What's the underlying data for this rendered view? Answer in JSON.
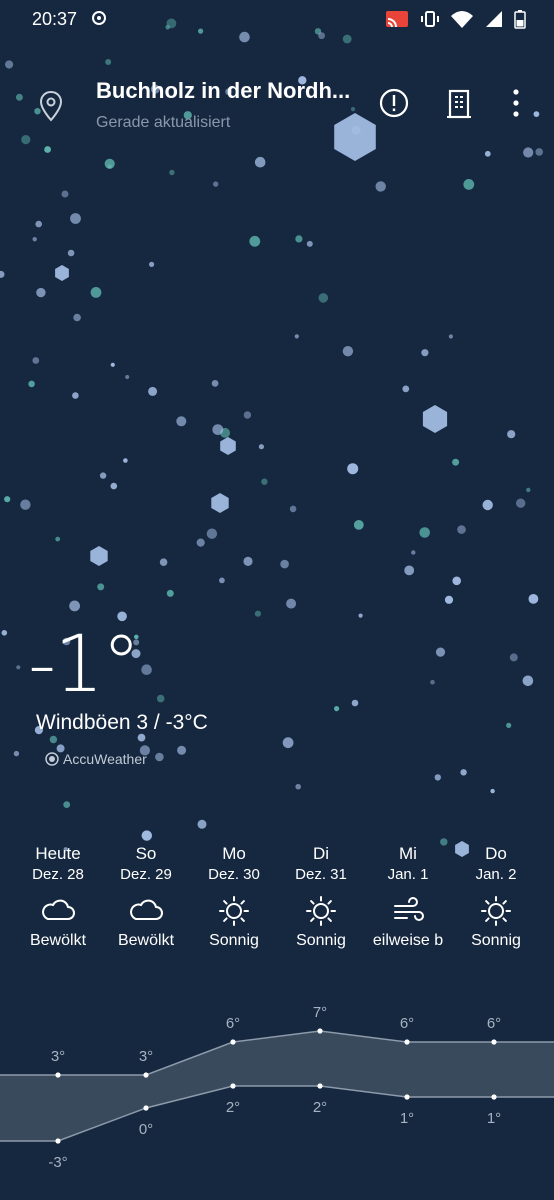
{
  "status_bar": {
    "time": "20:37"
  },
  "header": {
    "city": "Buchholz in der Nordh...",
    "updated": "Gerade aktualisiert",
    "icons": [
      "location-pin-icon",
      "alert-icon",
      "city-building-icon",
      "more-vert-icon"
    ]
  },
  "current": {
    "temperature": "-1°",
    "wind_gust": "Windböen  3 / -3°C",
    "provider": "AccuWeather"
  },
  "forecast": [
    {
      "day": "Heute",
      "date": "Dez. 28",
      "condition": "Bewölkt",
      "icon": "cloud-icon"
    },
    {
      "day": "So",
      "date": "Dez. 29",
      "condition": "Bewölkt",
      "icon": "cloud-icon"
    },
    {
      "day": "Mo",
      "date": "Dez. 30",
      "condition": "Sonnig",
      "icon": "sun-icon"
    },
    {
      "day": "Di",
      "date": "Dez. 31",
      "condition": "Sonnig",
      "icon": "sun-icon"
    },
    {
      "day": "Mi",
      "date": "Jan. 1",
      "condition": "eilweise b",
      "icon": "wind-icon"
    },
    {
      "day": "Do",
      "date": "Jan. 2",
      "condition": "Sonnig",
      "icon": "sun-icon"
    }
  ],
  "chart_data": {
    "type": "area",
    "categories": [
      "Heute",
      "So",
      "Mo",
      "Di",
      "Mi",
      "Do"
    ],
    "series": [
      {
        "values": [
          3,
          3,
          6,
          7,
          6,
          6
        ]
      },
      {
        "values": [
          -3,
          0,
          2,
          2,
          1,
          1
        ]
      }
    ],
    "high_labels": [
      "3°",
      "3°",
      "6°",
      "7°",
      "6°",
      "6°"
    ],
    "low_labels": [
      "-3°",
      "0°",
      "2°",
      "2°",
      "1°",
      "1°"
    ],
    "ylim": [
      -4,
      8
    ],
    "grid": false,
    "colors": {
      "band": "#3a4a5d",
      "line": "#8d9aab",
      "point": "#ffffff"
    }
  }
}
